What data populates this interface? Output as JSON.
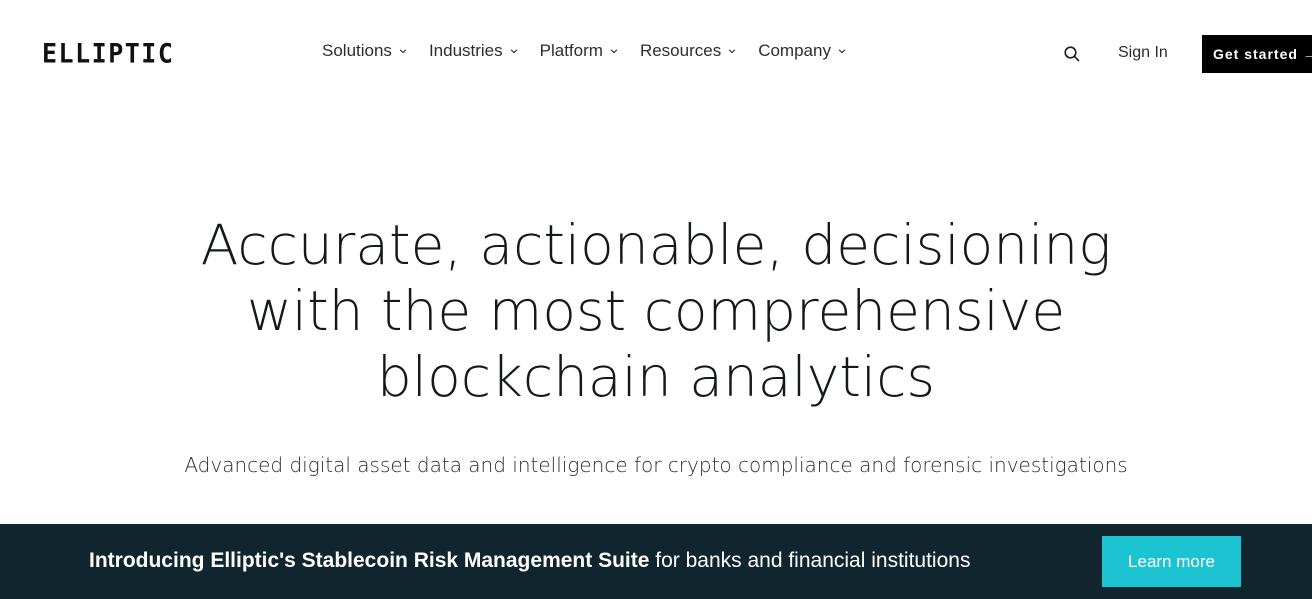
{
  "header": {
    "logo_text": "ELLIPTIC",
    "nav": [
      {
        "label": "Solutions",
        "icon": "chevron-down-icon"
      },
      {
        "label": "Industries",
        "icon": "chevron-down-icon"
      },
      {
        "label": "Platform",
        "icon": "chevron-down-icon"
      },
      {
        "label": "Resources",
        "icon": "chevron-down-icon"
      },
      {
        "label": "Company",
        "icon": "chevron-down-icon"
      }
    ],
    "search_icon": "search-icon",
    "sign_in_label": "Sign In",
    "get_started_label": "Get started →"
  },
  "hero": {
    "title_line1": "Accurate, actionable, decisioning",
    "title_line2": "with the most comprehensive",
    "title_line3": "blockchain analytics",
    "subtitle": "Advanced digital asset data and intelligence for crypto compliance and forensic investigations"
  },
  "banner": {
    "strong_text": "Introducing Elliptic's Stablecoin Risk Management Suite",
    "rest_text": " for banks and financial institutions",
    "button_label": "Learn more"
  },
  "colors": {
    "banner_bg": "#11252f",
    "accent": "#1cc4d2",
    "cta_bg": "#000000",
    "text": "#15181c"
  }
}
